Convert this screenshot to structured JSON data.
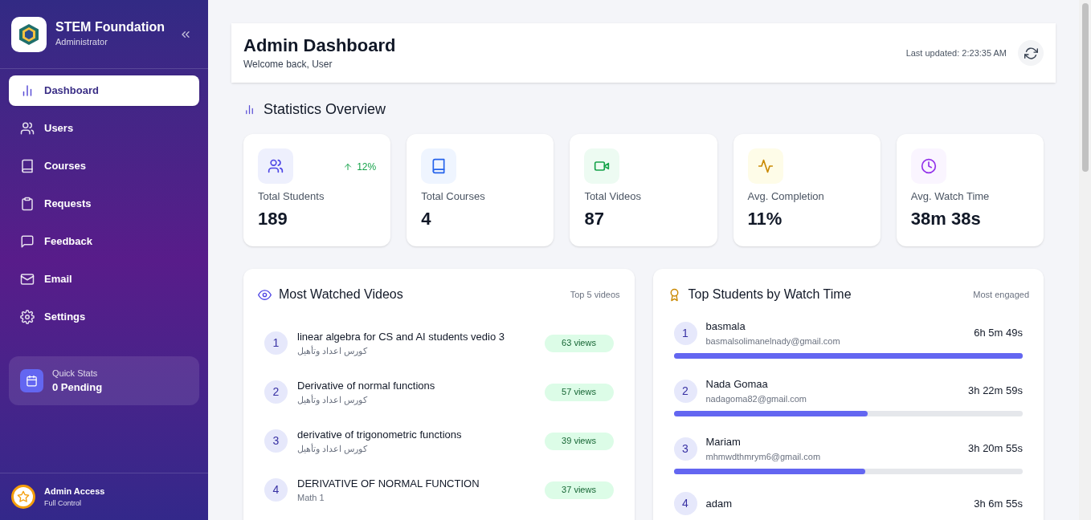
{
  "sidebar": {
    "brand": {
      "title": "STEM Foundation",
      "subtitle": "Administrator"
    },
    "items": [
      {
        "label": "Dashboard",
        "selected": true
      },
      {
        "label": "Users",
        "selected": false
      },
      {
        "label": "Courses",
        "selected": false
      },
      {
        "label": "Requests",
        "selected": false
      },
      {
        "label": "Feedback",
        "selected": false
      },
      {
        "label": "Email",
        "selected": false
      },
      {
        "label": "Settings",
        "selected": false
      }
    ],
    "quick_stats": {
      "label": "Quick Stats",
      "value": "0 Pending"
    },
    "footer": {
      "title": "Admin Access",
      "subtitle": "Full Control"
    }
  },
  "header": {
    "title": "Admin Dashboard",
    "subtitle": "Welcome back, User",
    "last_updated": "Last updated: 2:23:35 AM"
  },
  "statistics": {
    "title": "Statistics Overview",
    "cards": [
      {
        "label": "Total Students",
        "value": "189",
        "trend": "12%"
      },
      {
        "label": "Total Courses",
        "value": "4"
      },
      {
        "label": "Total Videos",
        "value": "87"
      },
      {
        "label": "Avg. Completion",
        "value": "11%"
      },
      {
        "label": "Avg. Watch Time",
        "value": "38m 38s"
      }
    ]
  },
  "most_watched": {
    "title": "Most Watched Videos",
    "note": "Top 5 videos",
    "rows": [
      {
        "rank": "1",
        "title": "linear algebra for CS and AI students vedio 3",
        "course": "كورس اعداد وتأهيل",
        "views": "63 views"
      },
      {
        "rank": "2",
        "title": "Derivative of normal functions",
        "course": "كورس اعداد وتأهيل",
        "views": "57 views"
      },
      {
        "rank": "3",
        "title": "derivative of trigonometric functions",
        "course": "كورس اعداد وتأهيل",
        "views": "39 views"
      },
      {
        "rank": "4",
        "title": "DERIVATIVE OF NORMAL FUNCTION",
        "course": "Math 1",
        "views": "37 views"
      }
    ]
  },
  "top_students": {
    "title": "Top Students by Watch Time",
    "note": "Most engaged",
    "rows": [
      {
        "rank": "1",
        "name": "basmala",
        "email": "basmalsolimanelnady@gmail.com",
        "time": "6h 5m 49s",
        "level": 1
      },
      {
        "rank": "2",
        "name": "Nada Gomaa",
        "email": "nadagoma82@gmail.com",
        "time": "3h 22m 59s",
        "level": 0.555
      },
      {
        "rank": "3",
        "name": "Mariam",
        "email": "mhmwdthmrym6@gmail.com",
        "time": "3h 20m 55s",
        "level": 0.548
      },
      {
        "rank": "4",
        "name": "adam",
        "time": "3h 6m 55s"
      }
    ]
  }
}
